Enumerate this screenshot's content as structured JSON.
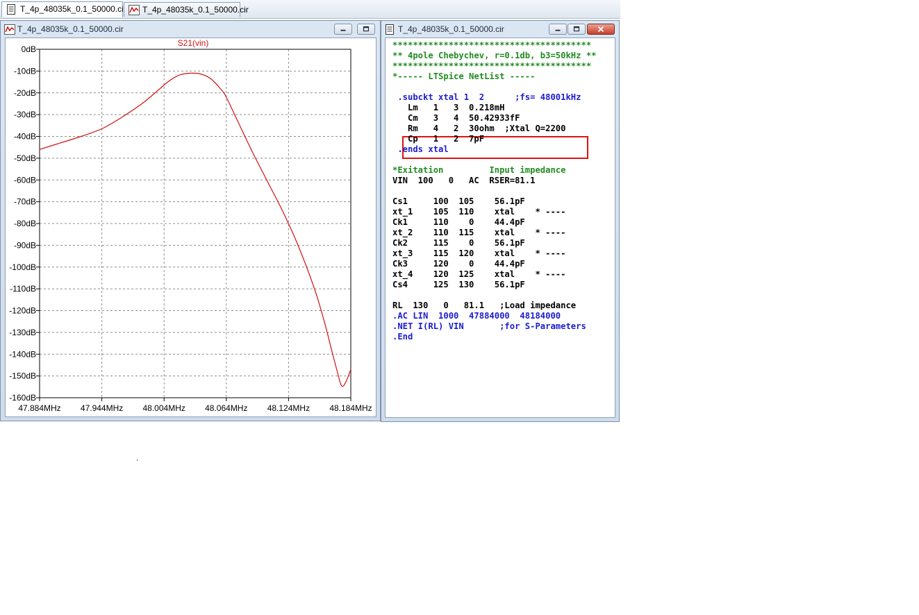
{
  "tabs": [
    {
      "label": "T_4p_48035k_0.1_50000.cir",
      "icon": "netlist-document-icon",
      "active": true
    },
    {
      "label": "T_4p_48035k_0.1_50000.cir",
      "icon": "waveform-plot-icon",
      "active": false
    }
  ],
  "plot_window": {
    "title": "T_4p_48035k_0.1_50000.cir",
    "icon": "waveform-plot-icon"
  },
  "netlist_window": {
    "title": "T_4p_48035k_0.1_50000.cir",
    "icon": "netlist-document-icon"
  },
  "chart_data": {
    "type": "line",
    "title": "",
    "series_label": "S21(vin)",
    "xlabel": "",
    "ylabel": "",
    "x_ticks": [
      "47.884MHz",
      "47.944MHz",
      "48.004MHz",
      "48.064MHz",
      "48.124MHz",
      "48.184MHz"
    ],
    "y_ticks": [
      "0dB",
      "-10dB",
      "-20dB",
      "-30dB",
      "-40dB",
      "-50dB",
      "-60dB",
      "-70dB",
      "-80dB",
      "-90dB",
      "-100dB",
      "-110dB",
      "-120dB",
      "-130dB",
      "-140dB",
      "-150dB",
      "-160dB"
    ],
    "xlim_mhz": [
      47.884,
      48.184
    ],
    "ylim_db": [
      -160,
      0
    ],
    "grid": true,
    "series": [
      {
        "name": "S21(vin)",
        "color": "#d01010",
        "x_mhz": [
          47.884,
          47.904,
          47.924,
          47.944,
          47.964,
          47.984,
          47.999,
          48.009,
          48.019,
          48.029,
          48.039,
          48.049,
          48.059,
          48.064,
          48.074,
          48.089,
          48.104,
          48.119,
          48.134,
          48.149,
          48.159,
          48.166,
          48.171,
          48.175,
          48.179,
          48.184
        ],
        "y_db": [
          -46,
          -43,
          -40,
          -36.5,
          -31,
          -24.5,
          -18.5,
          -14.5,
          -11.8,
          -11.0,
          -11.3,
          -13.5,
          -18.5,
          -22,
          -32,
          -47,
          -61,
          -75,
          -91,
          -110,
          -126,
          -139,
          -148,
          -154.5,
          -153,
          -147
        ]
      }
    ]
  },
  "netlist": {
    "lines": [
      {
        "text": "***************************************",
        "color": "green"
      },
      {
        "text": "** 4pole Chebychev, r=0.1db, b3=50kHz **",
        "color": "green"
      },
      {
        "text": "***************************************",
        "color": "green"
      },
      {
        "text": "*----- LTSpice NetList -----",
        "color": "green"
      },
      {
        "text": "",
        "color": "black"
      },
      {
        "text": " .subckt xtal 1  2      ;fs= 48001kHz",
        "color": "blue"
      },
      {
        "text": "   Lm   1   3  0.218mH",
        "color": "black"
      },
      {
        "text": "   Cm   3   4  50.42933fF",
        "color": "black"
      },
      {
        "text": "   Rm   4   2  30ohm  ;Xtal Q=2200",
        "color": "black"
      },
      {
        "text": "   Cp   1   2  7pF",
        "color": "black"
      },
      {
        "text": " .ends xtal",
        "color": "blue"
      },
      {
        "text": "",
        "color": "black"
      },
      {
        "text": "*Exitation         Input impedance",
        "color": "green"
      },
      {
        "text": "VIN  100   0   AC  RSER=81.1",
        "color": "black"
      },
      {
        "text": "",
        "color": "black"
      },
      {
        "text": "Cs1     100  105    56.1pF",
        "color": "black"
      },
      {
        "text": "xt_1    105  110    xtal    * ----",
        "color": "black"
      },
      {
        "text": "Ck1     110    0    44.4pF",
        "color": "black"
      },
      {
        "text": "xt_2    110  115    xtal    * ----",
        "color": "black"
      },
      {
        "text": "Ck2     115    0    56.1pF",
        "color": "black"
      },
      {
        "text": "xt_3    115  120    xtal    * ----",
        "color": "black"
      },
      {
        "text": "Ck3     120    0    44.4pF",
        "color": "black"
      },
      {
        "text": "xt_4    120  125    xtal    * ----",
        "color": "black"
      },
      {
        "text": "Cs4     125  130    56.1pF",
        "color": "black"
      },
      {
        "text": "",
        "color": "black"
      },
      {
        "text": "RL  130   0   81.1   ;Load impedance",
        "color": "black"
      },
      {
        "text": ".AC LIN  1000  47884000  48184000",
        "color": "blue"
      },
      {
        "text": ".NET I(RL) VIN       ;for S-Parameters",
        "color": "blue"
      },
      {
        "text": ".End",
        "color": "blue"
      }
    ],
    "highlight_note": "Rm / Cp lines boxed in red"
  }
}
